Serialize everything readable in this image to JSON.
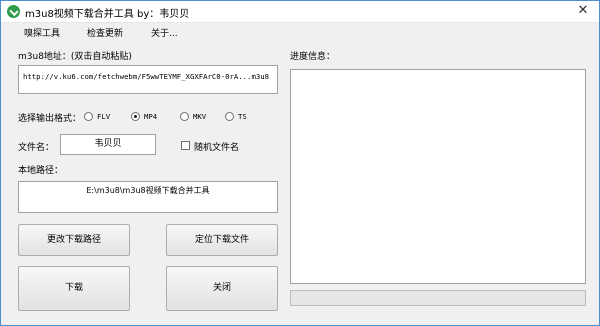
{
  "window": {
    "title": "m3u8视频下载合并工具 by：韦贝贝",
    "close_glyph": "✕"
  },
  "menu": {
    "items": [
      "嗅探工具",
      "检查更新",
      "关于..."
    ]
  },
  "m3u8": {
    "label": "m3u8地址：(双击自动粘贴)",
    "value": "http://v.ku6.com/fetchwebm/F5wwTEYMF_XGXFArC0-0rA...m3u8"
  },
  "format": {
    "label": "选择输出格式：",
    "options": [
      "FLV",
      "MP4",
      "MKV",
      "TS"
    ],
    "selected": "MP4"
  },
  "filename": {
    "label": "文件名：",
    "value": "韦贝贝",
    "random_label": "随机文件名",
    "random_checked": false
  },
  "local_path": {
    "label": "本地路径：",
    "value": "E:\\m3u8\\m3u8视频下载合并工具"
  },
  "buttons": {
    "change_path": "更改下载路径",
    "locate_file": "定位下载文件",
    "download": "下载",
    "close": "关闭"
  },
  "progress_info": {
    "label": "进度信息：",
    "text": ""
  },
  "progress_bar": {
    "value": 0
  }
}
